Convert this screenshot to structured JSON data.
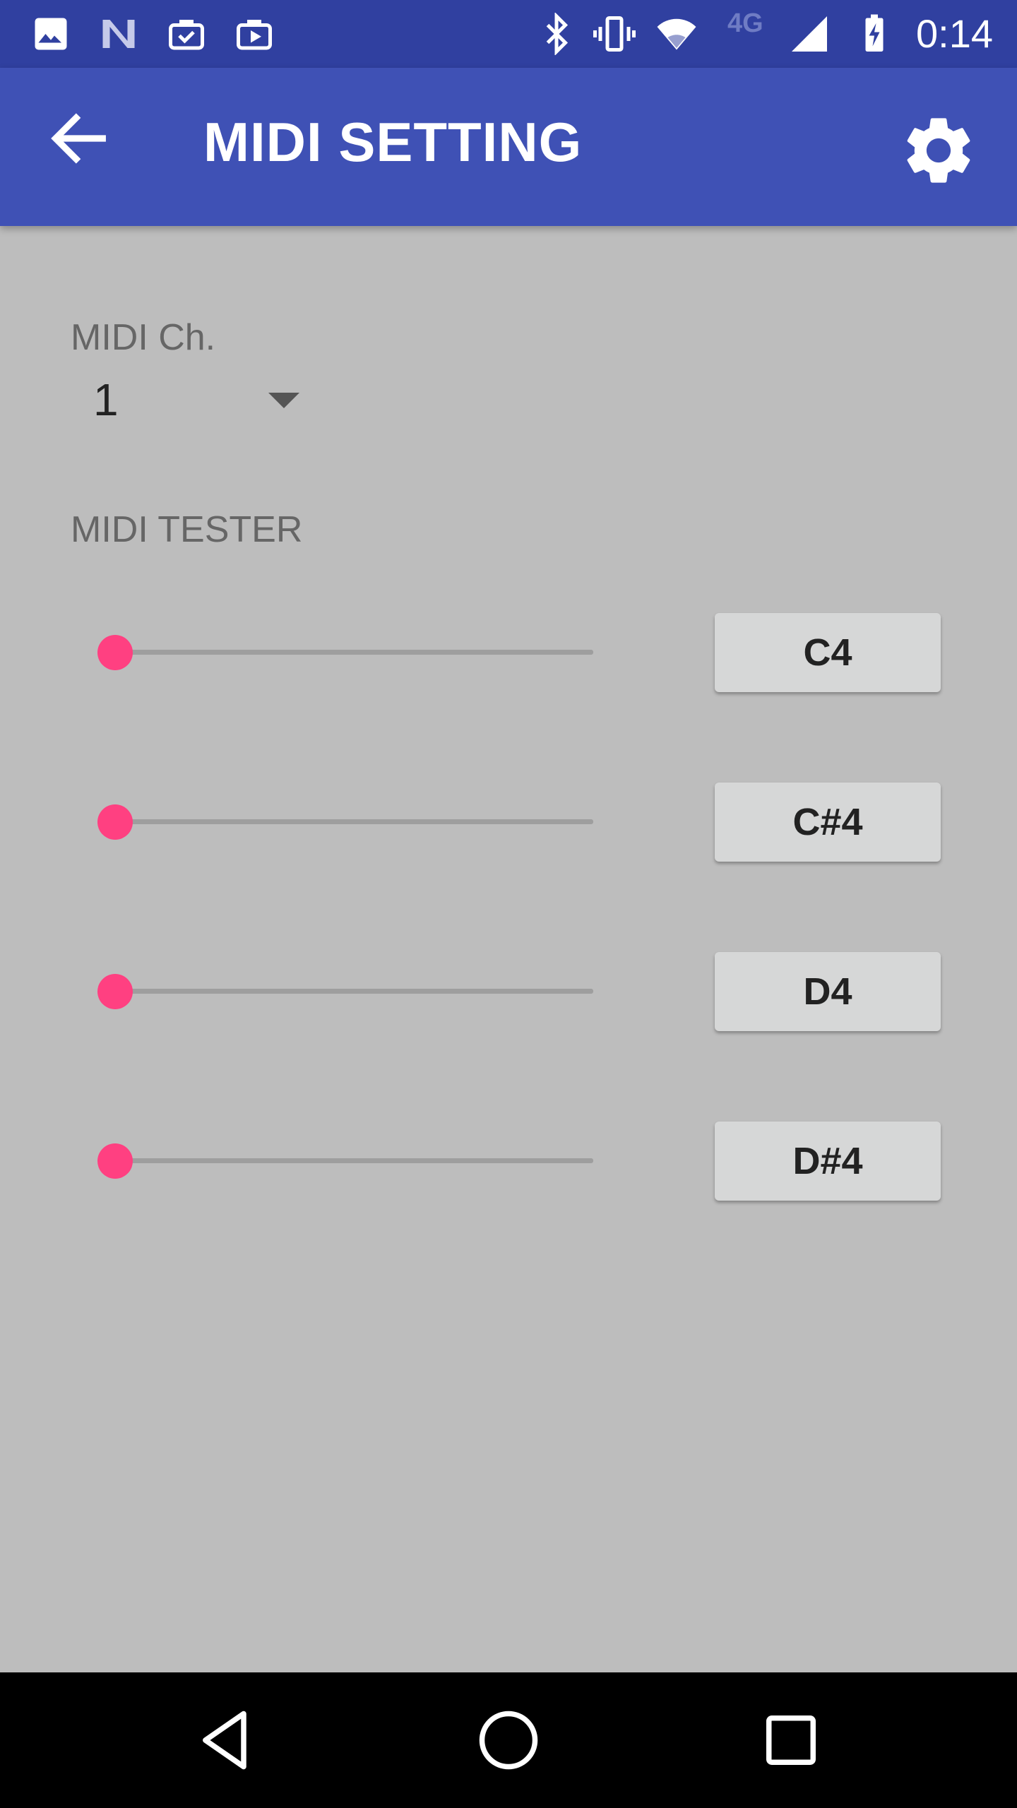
{
  "status_bar": {
    "time": "0:14",
    "network_label": "4G",
    "left_icons": [
      "image-icon",
      "n-logo-icon",
      "briefcase-check-icon",
      "briefcase-play-icon"
    ],
    "right_icons": [
      "bluetooth-icon",
      "vibrate-icon",
      "wifi-icon",
      "cell-signal-icon",
      "battery-charging-icon"
    ]
  },
  "app_bar": {
    "title": "MIDI SETTING",
    "background": "#3f51b5"
  },
  "midi_channel": {
    "label": "MIDI Ch.",
    "selected": "1"
  },
  "tester": {
    "label": "MIDI TESTER",
    "accent": "#ff4081",
    "rows": [
      {
        "note": "C4",
        "slider_value": 0
      },
      {
        "note": "C#4",
        "slider_value": 0
      },
      {
        "note": "D4",
        "slider_value": 0
      },
      {
        "note": "D#4",
        "slider_value": 0
      }
    ]
  },
  "nav_bar": {
    "buttons": [
      "back-triangle-icon",
      "home-circle-icon",
      "recents-square-icon"
    ]
  }
}
